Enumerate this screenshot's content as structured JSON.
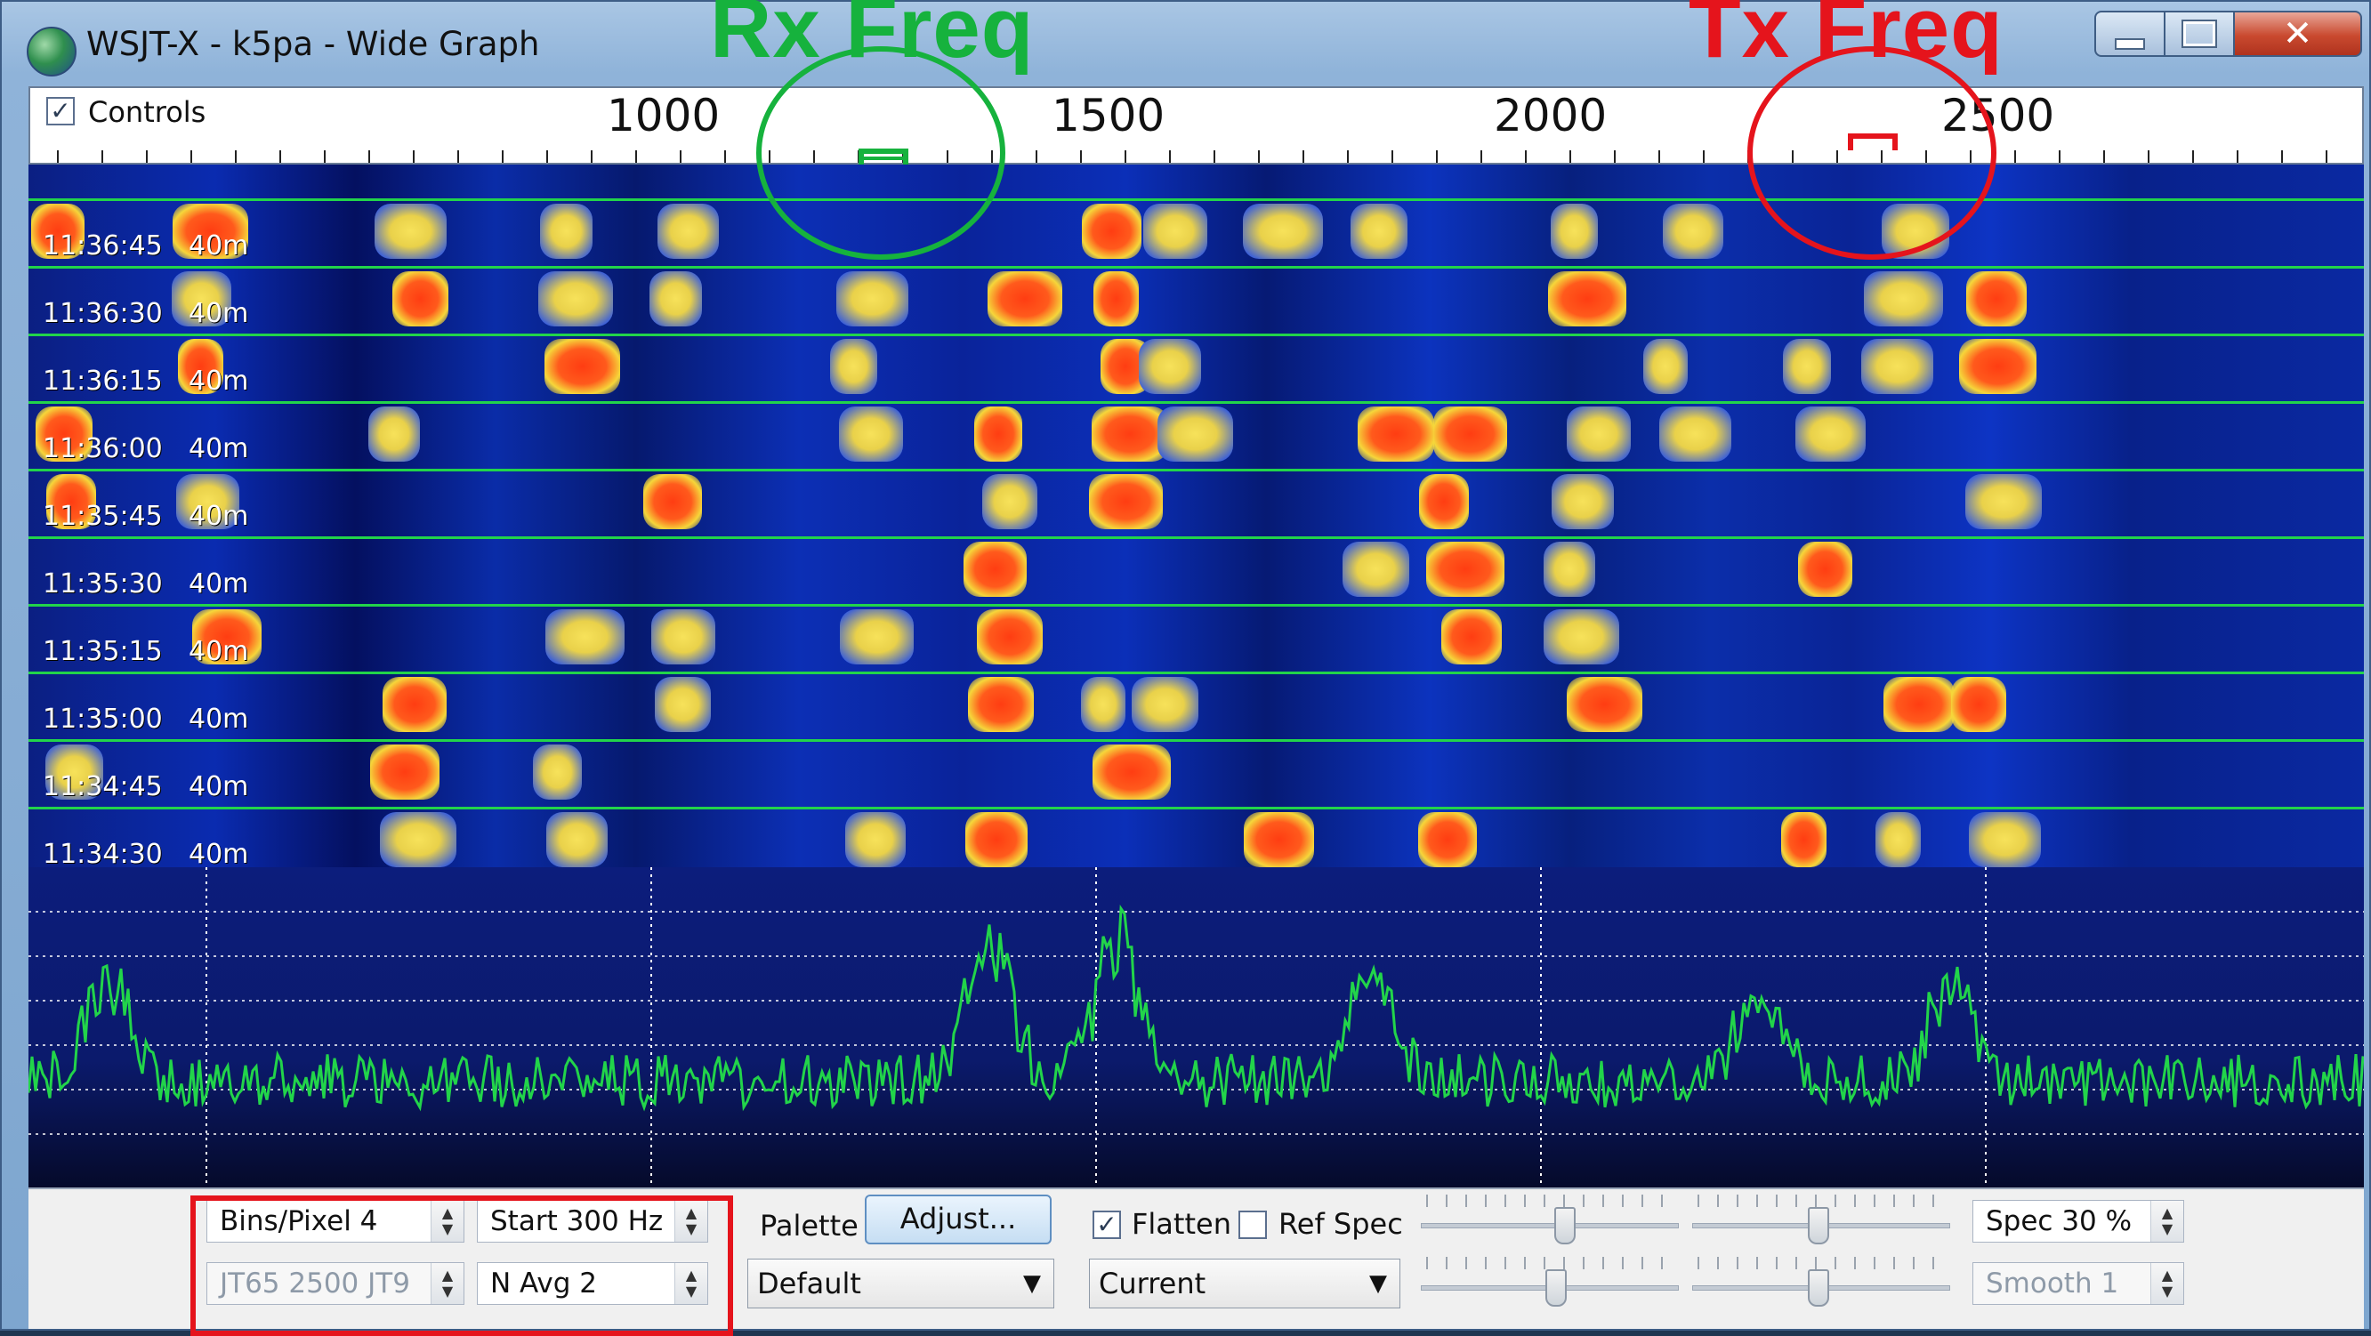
{
  "window": {
    "title": "WSJT-X - k5pa - Wide Graph"
  },
  "annotations": {
    "rx_freq": "Rx Freq",
    "tx_freq": "Tx Freq"
  },
  "scale": {
    "controls_label": "Controls",
    "controls_checked": true,
    "freq_labels": [
      "1000",
      "1500",
      "2000",
      "2500"
    ]
  },
  "waterfall": {
    "rows": [
      {
        "time": "11:36:45",
        "band": "40m"
      },
      {
        "time": "11:36:30",
        "band": "40m"
      },
      {
        "time": "11:36:15",
        "band": "40m"
      },
      {
        "time": "11:36:00",
        "band": "40m"
      },
      {
        "time": "11:35:45",
        "band": "40m"
      },
      {
        "time": "11:35:30",
        "band": "40m"
      },
      {
        "time": "11:35:15",
        "band": "40m"
      },
      {
        "time": "11:35:00",
        "band": "40m"
      },
      {
        "time": "11:34:45",
        "band": "40m"
      },
      {
        "time": "11:34:30",
        "band": "40m"
      }
    ]
  },
  "controls": {
    "bins_pixel": "Bins/Pixel  4",
    "start": "Start 300 Hz",
    "mode_split": "JT65  2500  JT9",
    "n_avg": "N Avg 2",
    "palette_label": "Palette",
    "adjust_button": "Adjust...",
    "palette_value": "Default",
    "flatten_label": "Flatten",
    "flatten_checked": true,
    "ref_spec_label": "Ref Spec",
    "ref_spec_checked": false,
    "spectrum_mode": "Current",
    "spec_pct": "Spec 30 %",
    "smooth": "Smooth  1"
  },
  "colors": {
    "rx_marker": "#16b23d",
    "tx_marker": "#e5141c",
    "trace": "#22d44a"
  }
}
